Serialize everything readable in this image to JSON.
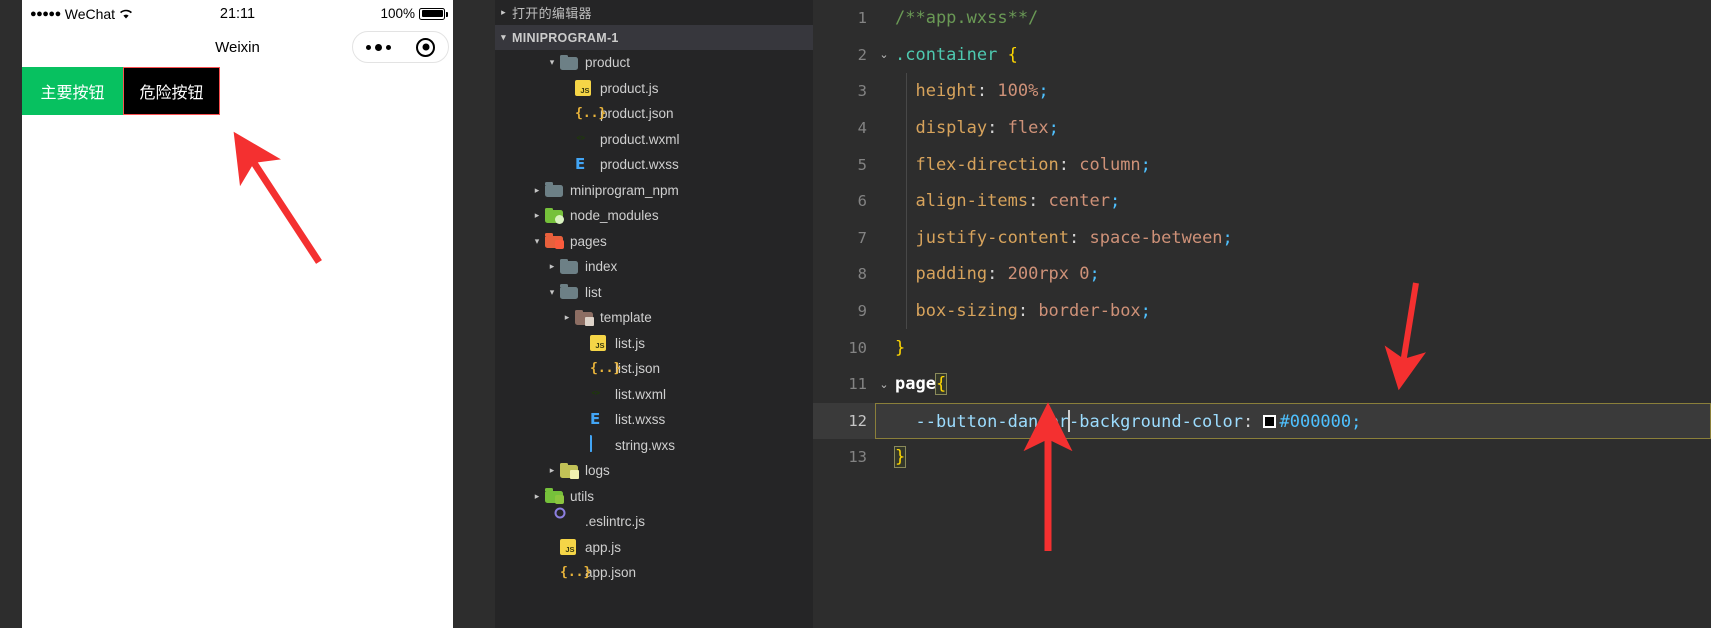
{
  "simulator": {
    "status_bar": {
      "dots": "●●●●●",
      "carrier": "WeChat",
      "wifi_icon": "wifi-icon",
      "time": "21:11",
      "battery_pct": "100%",
      "battery_icon": "battery-icon"
    },
    "nav": {
      "title": "Weixin",
      "menu_icon": "more-dots-icon",
      "target_icon": "target-circle-icon"
    },
    "buttons": [
      {
        "label": "主要按钮",
        "kind": "primary",
        "bg": "#07c160",
        "fg": "#ffffff"
      },
      {
        "label": "危险按钮",
        "kind": "danger",
        "bg": "#000000",
        "fg": "#ffffff",
        "border": "#fa5151"
      }
    ]
  },
  "explorer": {
    "open_editors": {
      "label": "打开的编辑器",
      "twisty": "▸"
    },
    "project": {
      "label": "MINIPROGRAM-1",
      "twisty": "▾"
    },
    "items": [
      {
        "label": "product",
        "type": "folder",
        "icon": "folder-grey-icon",
        "twisty": "▾",
        "indent": 3
      },
      {
        "label": "product.js",
        "type": "file",
        "icon": "js-icon",
        "twisty": "",
        "indent": 4
      },
      {
        "label": "product.json",
        "type": "file",
        "icon": "json-icon",
        "twisty": "",
        "indent": 4
      },
      {
        "label": "product.wxml",
        "type": "file",
        "icon": "wxml-icon",
        "twisty": "",
        "indent": 4
      },
      {
        "label": "product.wxss",
        "type": "file",
        "icon": "wxss-icon",
        "twisty": "",
        "indent": 4
      },
      {
        "label": "miniprogram_npm",
        "type": "folder",
        "icon": "folder-grey-icon",
        "twisty": "▸",
        "indent": 2
      },
      {
        "label": "node_modules",
        "type": "folder",
        "icon": "folder-node-icon",
        "twisty": "▸",
        "indent": 2
      },
      {
        "label": "pages",
        "type": "folder",
        "icon": "folder-pages-icon",
        "twisty": "▾",
        "indent": 2
      },
      {
        "label": "index",
        "type": "folder",
        "icon": "folder-grey-icon",
        "twisty": "▸",
        "indent": 3
      },
      {
        "label": "list",
        "type": "folder",
        "icon": "folder-grey-icon",
        "twisty": "▾",
        "indent": 3
      },
      {
        "label": "template",
        "type": "folder",
        "icon": "folder-tpl-icon",
        "twisty": "▸",
        "indent": 4
      },
      {
        "label": "list.js",
        "type": "file",
        "icon": "js-icon",
        "twisty": "",
        "indent": 5
      },
      {
        "label": "list.json",
        "type": "file",
        "icon": "json-icon",
        "twisty": "",
        "indent": 5
      },
      {
        "label": "list.wxml",
        "type": "file",
        "icon": "wxml-icon",
        "twisty": "",
        "indent": 5
      },
      {
        "label": "list.wxss",
        "type": "file",
        "icon": "wxss-icon",
        "twisty": "",
        "indent": 5
      },
      {
        "label": "string.wxs",
        "type": "file",
        "icon": "wxs-icon",
        "twisty": "",
        "indent": 5
      },
      {
        "label": "logs",
        "type": "folder",
        "icon": "folder-logs-icon",
        "twisty": "▸",
        "indent": 3
      },
      {
        "label": "utils",
        "type": "folder",
        "icon": "folder-utils-icon",
        "twisty": "▸",
        "indent": 2
      },
      {
        "label": ".eslintrc.js",
        "type": "file",
        "icon": "eslint-icon",
        "twisty": "",
        "indent": 3
      },
      {
        "label": "app.js",
        "type": "file",
        "icon": "js-icon",
        "twisty": "",
        "indent": 3
      },
      {
        "label": "app.json",
        "type": "file",
        "icon": "json-icon",
        "twisty": "",
        "indent": 3
      }
    ]
  },
  "editor": {
    "filename_comment": "/**app.wxss**/",
    "active_line": 12,
    "color_swatch_hex": "#000000",
    "lines": [
      {
        "n": "1",
        "fold": "",
        "tokens": [
          {
            "t": "/**app.wxss**/",
            "c": "t-comment"
          }
        ]
      },
      {
        "n": "2",
        "fold": "⌄",
        "tokens": [
          {
            "t": ".container ",
            "c": "t-sel"
          },
          {
            "t": "{",
            "c": "t-brace"
          }
        ]
      },
      {
        "n": "3",
        "fold": "",
        "tokens": [
          {
            "t": "  height",
            "c": "t-prop"
          },
          {
            "t": ": ",
            "c": "t-punct"
          },
          {
            "t": "100%",
            "c": "t-val"
          },
          {
            "t": ";",
            "c": "t-semi"
          }
        ]
      },
      {
        "n": "4",
        "fold": "",
        "tokens": [
          {
            "t": "  display",
            "c": "t-prop"
          },
          {
            "t": ": ",
            "c": "t-punct"
          },
          {
            "t": "flex",
            "c": "t-val"
          },
          {
            "t": ";",
            "c": "t-semi"
          }
        ]
      },
      {
        "n": "5",
        "fold": "",
        "tokens": [
          {
            "t": "  flex-direction",
            "c": "t-prop"
          },
          {
            "t": ": ",
            "c": "t-punct"
          },
          {
            "t": "column",
            "c": "t-val"
          },
          {
            "t": ";",
            "c": "t-semi"
          }
        ]
      },
      {
        "n": "6",
        "fold": "",
        "tokens": [
          {
            "t": "  align-items",
            "c": "t-prop"
          },
          {
            "t": ": ",
            "c": "t-punct"
          },
          {
            "t": "center",
            "c": "t-val"
          },
          {
            "t": ";",
            "c": "t-semi"
          }
        ]
      },
      {
        "n": "7",
        "fold": "",
        "tokens": [
          {
            "t": "  justify-content",
            "c": "t-prop"
          },
          {
            "t": ": ",
            "c": "t-punct"
          },
          {
            "t": "space-between",
            "c": "t-val"
          },
          {
            "t": ";",
            "c": "t-semi"
          }
        ]
      },
      {
        "n": "8",
        "fold": "",
        "tokens": [
          {
            "t": "  padding",
            "c": "t-prop"
          },
          {
            "t": ": ",
            "c": "t-punct"
          },
          {
            "t": "200rpx",
            "c": "t-val"
          },
          {
            "t": " ",
            "c": "t-punct"
          },
          {
            "t": "0",
            "c": "t-val"
          },
          {
            "t": ";",
            "c": "t-semi"
          }
        ]
      },
      {
        "n": "9",
        "fold": "",
        "tokens": [
          {
            "t": "  box-sizing",
            "c": "t-prop"
          },
          {
            "t": ": ",
            "c": "t-punct"
          },
          {
            "t": "border-box",
            "c": "t-val"
          },
          {
            "t": ";",
            "c": "t-semi"
          }
        ]
      },
      {
        "n": "10",
        "fold": "",
        "tokens": [
          {
            "t": "}",
            "c": "t-brace"
          }
        ]
      },
      {
        "n": "11",
        "fold": "⌄",
        "tokens": [
          {
            "t": "page",
            "c": "t-page"
          },
          {
            "t": "{",
            "c": "t-brace brk"
          }
        ]
      },
      {
        "n": "12",
        "fold": "",
        "tokens": [
          {
            "t": "  --button-danger",
            "c": "t-var"
          },
          {
            "t": "CARET",
            "c": "caret-mark"
          },
          {
            "t": "-background-color",
            "c": "t-var"
          },
          {
            "t": ": ",
            "c": "t-punct"
          },
          {
            "t": "SWATCH",
            "c": "swatch-mark"
          },
          {
            "t": "#000000",
            "c": "t-hex"
          },
          {
            "t": ";",
            "c": "t-semi"
          }
        ]
      },
      {
        "n": "13",
        "fold": "",
        "tokens": [
          {
            "t": "}",
            "c": "t-brace brk"
          }
        ]
      }
    ]
  },
  "annotations": {
    "arrow_color": "#f43030",
    "arrows": [
      {
        "name": "arrow-to-danger-button",
        "points_at": "危险按钮"
      },
      {
        "name": "arrow-to-css-variable-line",
        "points_at": "--button-danger-background-color"
      },
      {
        "name": "arrow-to-hex-value",
        "points_at": "#000000"
      }
    ]
  }
}
